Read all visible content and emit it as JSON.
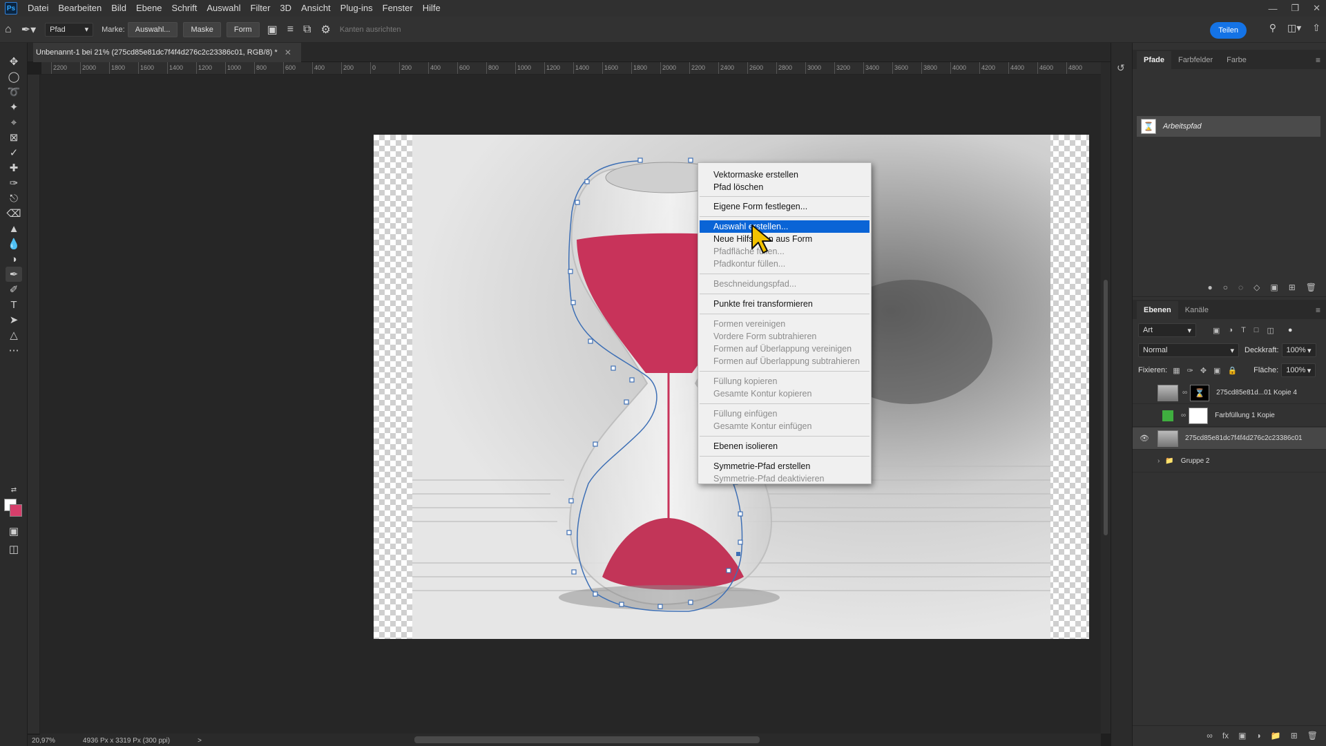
{
  "app": {
    "logo": "Ps"
  },
  "menubar": [
    "Datei",
    "Bearbeiten",
    "Bild",
    "Ebene",
    "Schrift",
    "Auswahl",
    "Filter",
    "3D",
    "Ansicht",
    "Plug-ins",
    "Fenster",
    "Hilfe"
  ],
  "options": {
    "tool_mode": "Pfad",
    "make_label": "Marke:",
    "selection_btn": "Auswahl...",
    "mask_btn": "Maske",
    "shape_btn": "Form",
    "align_edges": "Kanten ausrichten",
    "share_btn": "Teilen"
  },
  "document": {
    "tab_title": "Unbenannt-1 bei 21% (275cd85e81dc7f4f4d276c2c23386c01, RGB/8) *"
  },
  "ruler": [
    "2200",
    "2000",
    "1800",
    "1600",
    "1400",
    "1200",
    "1000",
    "800",
    "600",
    "400",
    "200",
    "0",
    "200",
    "400",
    "600",
    "800",
    "1000",
    "1200",
    "1400",
    "1600",
    "1800",
    "2000",
    "2200",
    "2400",
    "2600",
    "2800",
    "3000",
    "3200",
    "3400",
    "3600",
    "3800",
    "4000",
    "4200",
    "4400",
    "4600",
    "4800"
  ],
  "status": {
    "zoom": "20,97%",
    "doc_size": "4936 Px x 3319 Px (300 ppi)",
    "arrow": ">"
  },
  "context_menu": {
    "items": [
      {
        "label": "Vektormaske erstellen",
        "disabled": false
      },
      {
        "label": "Pfad löschen",
        "disabled": false
      },
      {
        "label": "Eigene Form festlegen...",
        "disabled": false
      },
      {
        "label": "Auswahl erstellen...",
        "disabled": false,
        "highlighted": true
      },
      {
        "label": "Neue Hilfslinien aus Form",
        "disabled": false
      },
      {
        "label": "Pfadfläche füllen...",
        "disabled": true
      },
      {
        "label": "Pfadkontur füllen...",
        "disabled": true
      },
      {
        "label": "Beschneidungspfad...",
        "disabled": true
      },
      {
        "label": "Punkte frei transformieren",
        "disabled": false
      },
      {
        "label": "Formen vereinigen",
        "disabled": true
      },
      {
        "label": "Vordere Form subtrahieren",
        "disabled": true
      },
      {
        "label": "Formen auf Überlappung vereinigen",
        "disabled": true
      },
      {
        "label": "Formen auf Überlappung subtrahieren",
        "disabled": true
      },
      {
        "label": "Füllung kopieren",
        "disabled": true
      },
      {
        "label": "Gesamte Kontur kopieren",
        "disabled": true
      },
      {
        "label": "Füllung einfügen",
        "disabled": true
      },
      {
        "label": "Gesamte Kontur einfügen",
        "disabled": true
      },
      {
        "label": "Ebenen isolieren",
        "disabled": false
      },
      {
        "label": "Symmetrie-Pfad erstellen",
        "disabled": false
      },
      {
        "label": "Symmetrie-Pfad deaktivieren",
        "disabled": true
      }
    ]
  },
  "paths_panel": {
    "tabs": [
      "Pfade",
      "Farbfelder",
      "Farbe"
    ],
    "active_tab": "Pfade",
    "path_name": "Arbeitspfad"
  },
  "layers_panel": {
    "tabs": [
      "Ebenen",
      "Kanäle"
    ],
    "filter": "Art",
    "blend_mode": "Normal",
    "opacity_label": "Deckkraft:",
    "opacity": "100%",
    "lock_label": "Fixieren:",
    "fill_label": "Fläche:",
    "fill": "100%",
    "layers": [
      {
        "name": "275cd85e81d...01 Kopie 4",
        "visible": false,
        "selected": false
      },
      {
        "name": "Farbfüllung 1 Kopie",
        "visible": false,
        "selected": false
      },
      {
        "name": "275cd85e81dc7f4f4d276c2c23386c01",
        "visible": true,
        "selected": true
      },
      {
        "name": "Gruppe 2",
        "visible": false,
        "selected": false
      }
    ]
  },
  "colors": {
    "accent": "#1473e6",
    "highlight": "#0a64d6",
    "sand": "#c8335a"
  }
}
